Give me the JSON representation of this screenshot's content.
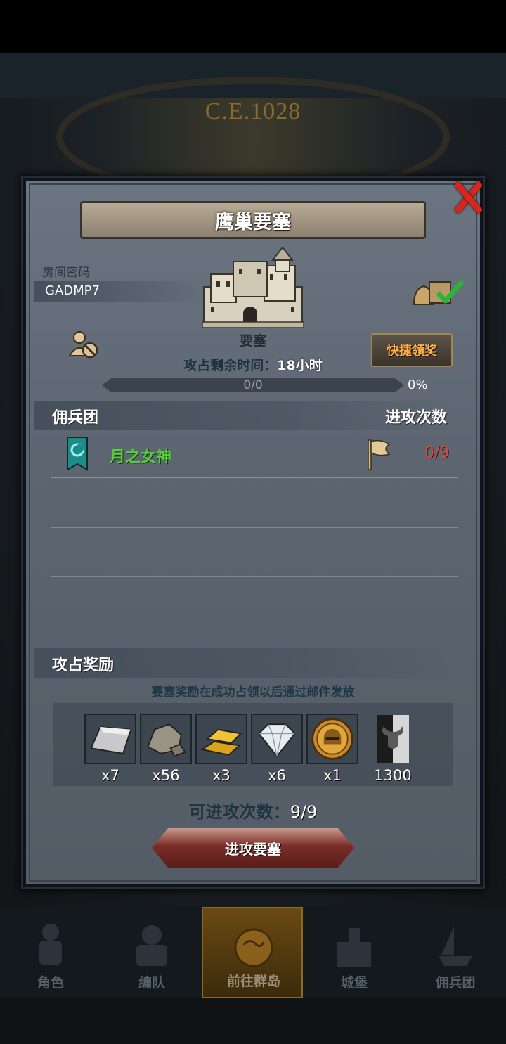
{
  "background": {
    "era": "C.E.1028"
  },
  "dialog": {
    "title": "鹰巢要塞",
    "room_label": "房间密码",
    "room_code": "GADMP7",
    "castle_name": "要塞",
    "claim_button": "快捷领奖",
    "time_label": "攻占剩余时间：",
    "time_value": "18小时",
    "progress": {
      "text": "0/0",
      "percent_text": "0%",
      "fraction": 0
    },
    "mercenary_header": "佣兵团",
    "attacks_header": "进攻次数",
    "guild": {
      "name": "月之女神",
      "attacks": "0/9"
    },
    "reward_header": "攻占奖励",
    "reward_note": "要塞奖励在成功占领以后通过邮件发放",
    "rewards": [
      {
        "icon": "silver-ingot-icon",
        "qty": "x7"
      },
      {
        "icon": "stone-ore-icon",
        "qty": "x56"
      },
      {
        "icon": "gold-bars-icon",
        "qty": "x3"
      },
      {
        "icon": "diamond-icon",
        "qty": "x6"
      },
      {
        "icon": "knight-helmet-coin-icon",
        "qty": "x1"
      },
      {
        "icon": "bull-banner-icon",
        "qty": "1300"
      }
    ],
    "attacks_left_label": "可进攻次数：",
    "attacks_left_value": "9/9",
    "attack_button": "进攻要塞"
  },
  "nav": [
    {
      "label": "角色",
      "icon": "knight-icon"
    },
    {
      "label": "编队",
      "icon": "formation-icon"
    },
    {
      "label": "前往群岛",
      "icon": "compass-map-icon"
    },
    {
      "label": "城堡",
      "icon": "castle-icon"
    },
    {
      "label": "佣兵团",
      "icon": "mercenary-ship-icon"
    }
  ],
  "colors": {
    "guild_name": "#54d03c",
    "attack_count": "#d74a3d",
    "claim_text": "#ffb14a"
  }
}
